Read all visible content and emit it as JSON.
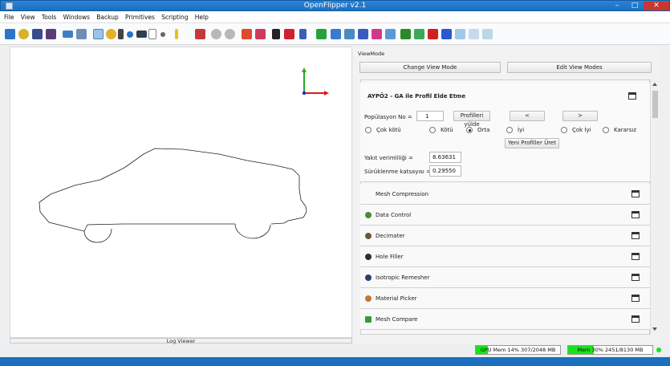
{
  "window": {
    "title": "OpenFlipper v2.1",
    "minimize": "–",
    "maximize": "□",
    "close": "✕"
  },
  "menu": [
    "File",
    "View",
    "Tools",
    "Windows",
    "Backup",
    "Primitives",
    "Scripting",
    "Help"
  ],
  "toolbar_icons": [
    "save-icon",
    "open-icon",
    "save-disk-icon",
    "save-as-icon",
    "layout-icon",
    "view-icon",
    "selection-icon",
    "pick-icon",
    "pointer-icon",
    "info-icon",
    "draw-mode-icon",
    "dropdown-icon",
    "more-icon",
    "measure-icon",
    "move-icon",
    "undo-icon",
    "redo-icon",
    "rotate-icon",
    "translate-icon",
    "sketch-icon",
    "cube-icon",
    "skeleton-icon",
    "paint-icon",
    "mesh-icon",
    "curve-icon",
    "plane-icon",
    "surface-icon",
    "cone-icon",
    "box-icon",
    "color-box-icon",
    "red-box-icon",
    "blue-box-icon",
    "light-box-icon",
    "grid-icon",
    "wire-icon"
  ],
  "colors": {
    "accent": "#1b6fbf",
    "green": "#18e21c",
    "axis_x": "#e01818",
    "axis_y": "#20b020",
    "axis_z": "#1a2fd0"
  },
  "viewmode": {
    "section_label": "ViewMode",
    "change_btn": "Change View Mode",
    "edit_btn": "Edit View Modes"
  },
  "plugin": {
    "title": "AYPÖ2 - GA ile Profil Elde Etme",
    "population_label": "Popülasyon No =",
    "population_value": "1",
    "load_profiles_btn": "Profilleri yülde",
    "prev_btn": "<",
    "next_btn": ">",
    "ratings": [
      {
        "label": "Çok kötü",
        "selected": false
      },
      {
        "label": "Kötü",
        "selected": false
      },
      {
        "label": "Orta",
        "selected": true
      },
      {
        "label": "İyi",
        "selected": false
      },
      {
        "label": "Çok İyi",
        "selected": false
      },
      {
        "label": "Kararsız",
        "selected": false
      }
    ],
    "new_profiles_btn": "Yeni Profiller Üret",
    "fuel_label": "Yakıt verimliliği =",
    "fuel_value": "8.63631",
    "drag_label": "Sürüklenme katsayısı =",
    "drag_value": "0.29550"
  },
  "plugins": [
    {
      "label": "Mesh Compression",
      "icon": "blank-icon",
      "color": "#f9f9f9"
    },
    {
      "label": "Data Control",
      "icon": "data-control-icon",
      "color": "#4a8a3c"
    },
    {
      "label": "Decimater",
      "icon": "decimater-icon",
      "color": "#6b5a3a"
    },
    {
      "label": "Hole Filler",
      "icon": "hole-filler-icon",
      "color": "#2d2d2d"
    },
    {
      "label": "Isotropic Remesher",
      "icon": "remesher-icon",
      "color": "#2c3e6a"
    },
    {
      "label": "Material Picker",
      "icon": "material-picker-icon",
      "color": "#c07a2a"
    },
    {
      "label": "Mesh Compare",
      "icon": "mesh-compare-icon",
      "color": "#3a9a3a"
    }
  ],
  "log_viewer": "Log Viewer",
  "status": {
    "gpu": "GPU Mem 14% 307/2048 MB",
    "gpu_pct": 14,
    "mem": "Mem 30% 2451/8130 MB",
    "mem_pct": 30
  }
}
